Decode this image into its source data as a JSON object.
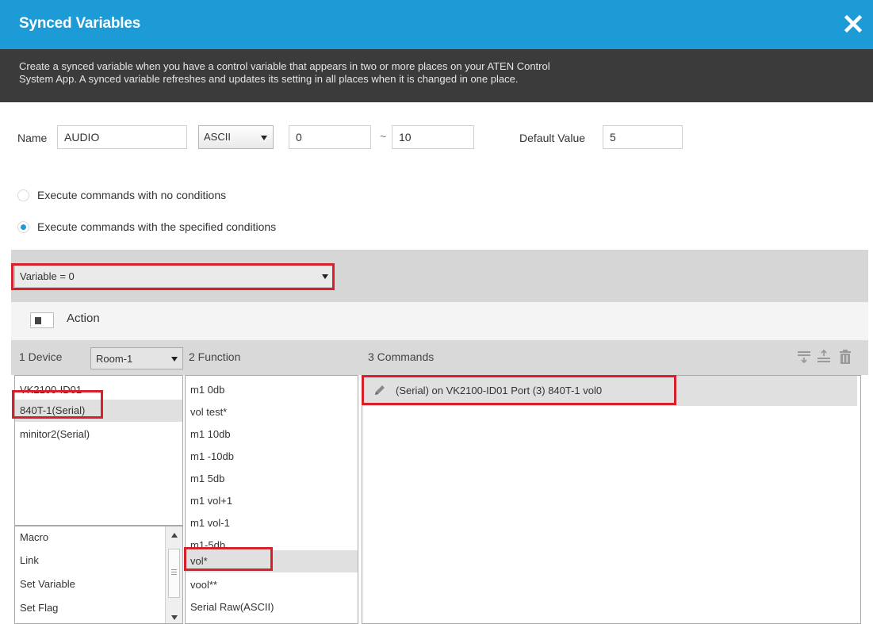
{
  "dialog": {
    "title": "Synced Variables",
    "close_icon": "close-icon",
    "description_line1": "Create a synced variable when you have a control variable that appears in two or more places on your ATEN Control",
    "description_line2": "System App. A synced variable refreshes and updates its setting in all places when it is changed in one place."
  },
  "form": {
    "name_label": "Name",
    "name_value": "AUDIO",
    "type_value": "ASCII",
    "min_value": "0",
    "range_separator": "~",
    "max_value": "10",
    "default_label": "Default Value",
    "default_value": "5"
  },
  "radios": [
    {
      "label": "Execute commands with no conditions",
      "checked": false
    },
    {
      "label": "Execute commands with the specified conditions",
      "checked": true
    }
  ],
  "condition": {
    "value": "Variable = 0"
  },
  "action": {
    "label": "Action"
  },
  "columns": {
    "device_header": "1  Device",
    "room_value": "Room-1",
    "function_header": "2  Function",
    "commands_header": "3  Commands",
    "toolbar_icons": [
      "insert-below-icon",
      "insert-above-icon",
      "trash-icon"
    ]
  },
  "devices": [
    {
      "label": "VK2100-ID01",
      "selected": false
    },
    {
      "label": "840T-1(Serial)",
      "selected": true
    },
    {
      "label": "minitor2(Serial)",
      "selected": false
    }
  ],
  "device_types": [
    "Macro",
    "Link",
    "Set Variable",
    "Set Flag"
  ],
  "functions": [
    {
      "label": "m1 0db",
      "selected": false
    },
    {
      "label": "vol test*",
      "selected": false
    },
    {
      "label": "m1 10db",
      "selected": false
    },
    {
      "label": "m1 -10db",
      "selected": false
    },
    {
      "label": "m1 5db",
      "selected": false
    },
    {
      "label": "m1 vol+1",
      "selected": false
    },
    {
      "label": "m1 vol-1",
      "selected": false
    },
    {
      "label": "m1-5db",
      "selected": false
    },
    {
      "label": "vol*",
      "selected": true
    },
    {
      "label": "vool**",
      "selected": false
    },
    {
      "label": "Serial Raw(ASCII)",
      "selected": false
    }
  ],
  "commands": [
    {
      "label": "(Serial) on VK2100-ID01 Port (3) 840T-1 vol0",
      "icon": "pencil-icon"
    }
  ],
  "colors": {
    "title_bar": "#1c9bd6",
    "description_bar": "#3b3b3b",
    "highlight": "#d8202b",
    "radio_on": "#1c9bd6"
  }
}
